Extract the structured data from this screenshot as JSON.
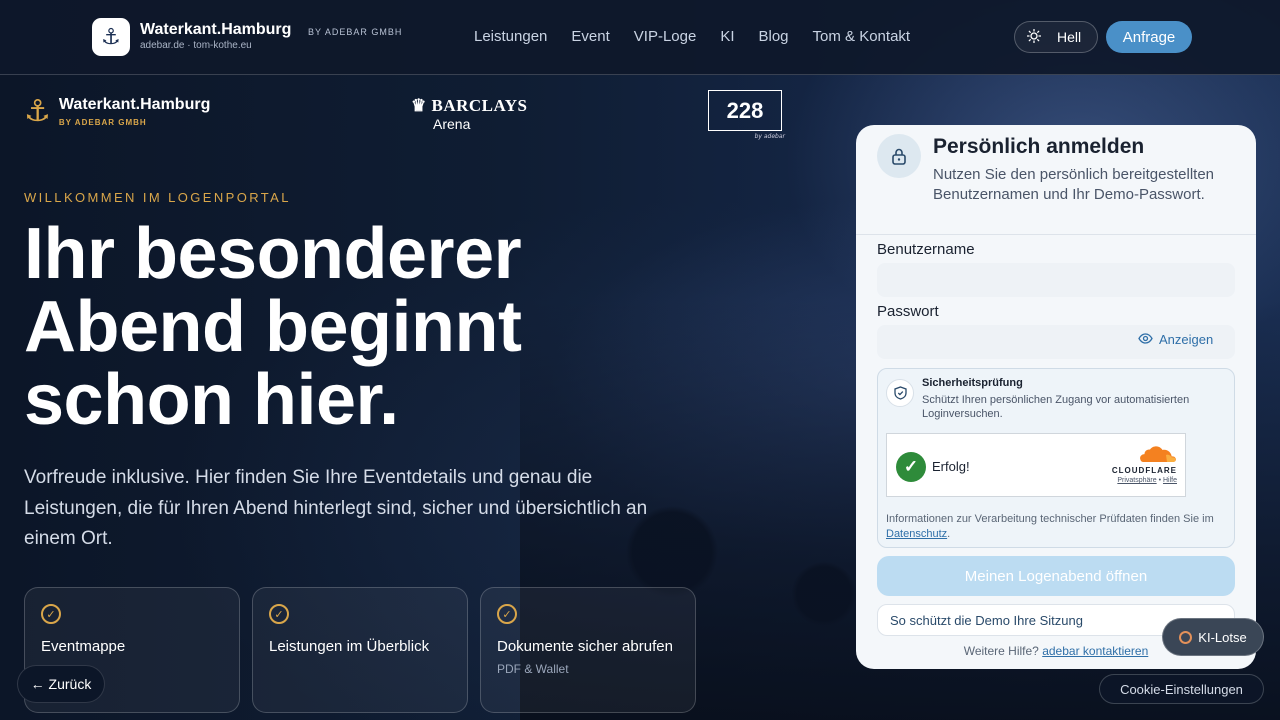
{
  "header": {
    "brand_name": "Waterkant.Hamburg",
    "brand_by": "BY ADEBAR GMBH",
    "brand_links": "adebar.de · tom-kothe.eu",
    "nav": [
      {
        "label": "Leistungen"
      },
      {
        "label": "Event"
      },
      {
        "label": "VIP-Loge"
      },
      {
        "label": "KI"
      },
      {
        "label": "Blog"
      },
      {
        "label": "Tom & Kontakt"
      }
    ],
    "theme_label": "Hell",
    "cta_label": "Anfrage"
  },
  "partners": {
    "waterkant_name": "Waterkant.Hamburg",
    "waterkant_by": "BY ADEBAR GMBH",
    "barclays_main": "BARCLAYS",
    "barclays_sub": "Arena",
    "loge_number": "228",
    "loge_tag": "by adebar"
  },
  "hero": {
    "eyebrow": "WILLKOMMEN IM LOGENPORTAL",
    "title_line1": "Ihr besonderer",
    "title_line2": "Abend beginnt",
    "title_line3": "schon hier.",
    "text": "Vorfreude inklusive. Hier finden Sie Ihre Eventdetails und genau die Leistungen, die für Ihren Abend hinterlegt sind, sicher und übersichtlich an einem Ort.",
    "features": [
      {
        "title": "Eventmappe",
        "sub": ""
      },
      {
        "title": "Leistungen im Überblick",
        "sub": ""
      },
      {
        "title": "Dokumente sicher abrufen",
        "sub": "PDF & Wallet"
      }
    ],
    "back_label": "← Zurück"
  },
  "login": {
    "title": "Persönlich anmelden",
    "description": "Nutzen Sie den persönlich bereitgestellten Benutzernamen und Ihr Demo-Passwort.",
    "username_label": "Benutzername",
    "username_value": "",
    "password_label": "Passwort",
    "password_value": "",
    "show_label": "Anzeigen",
    "security_title": "Sicherheitsprüfung",
    "security_desc": "Schützt Ihren persönlichen Zugang vor automatisierten Loginversuchen.",
    "captcha_status": "Erfolg!",
    "captcha_brand": "CLOUDFLARE",
    "captcha_privacy": "Privatsphäre",
    "captcha_sep": " • ",
    "captcha_help": "Hilfe",
    "privacy_text": "Informationen zur Verarbeitung technischer Prüfdaten finden Sie im ",
    "privacy_link": "Datenschutz",
    "privacy_end": ".",
    "submit_label": "Meinen Logenabend öffnen",
    "protect_label": "So schützt die Demo Ihre Sitzung",
    "help_text": "Weitere Hilfe? ",
    "help_link": "adebar kontaktieren"
  },
  "floating": {
    "ki_label": "KI-Lotse",
    "cookie_label": "Cookie-Einstellungen"
  },
  "colors": {
    "accent_gold": "#d9a64a",
    "accent_blue": "#4a90c8",
    "success_green": "#2e8b3a"
  }
}
